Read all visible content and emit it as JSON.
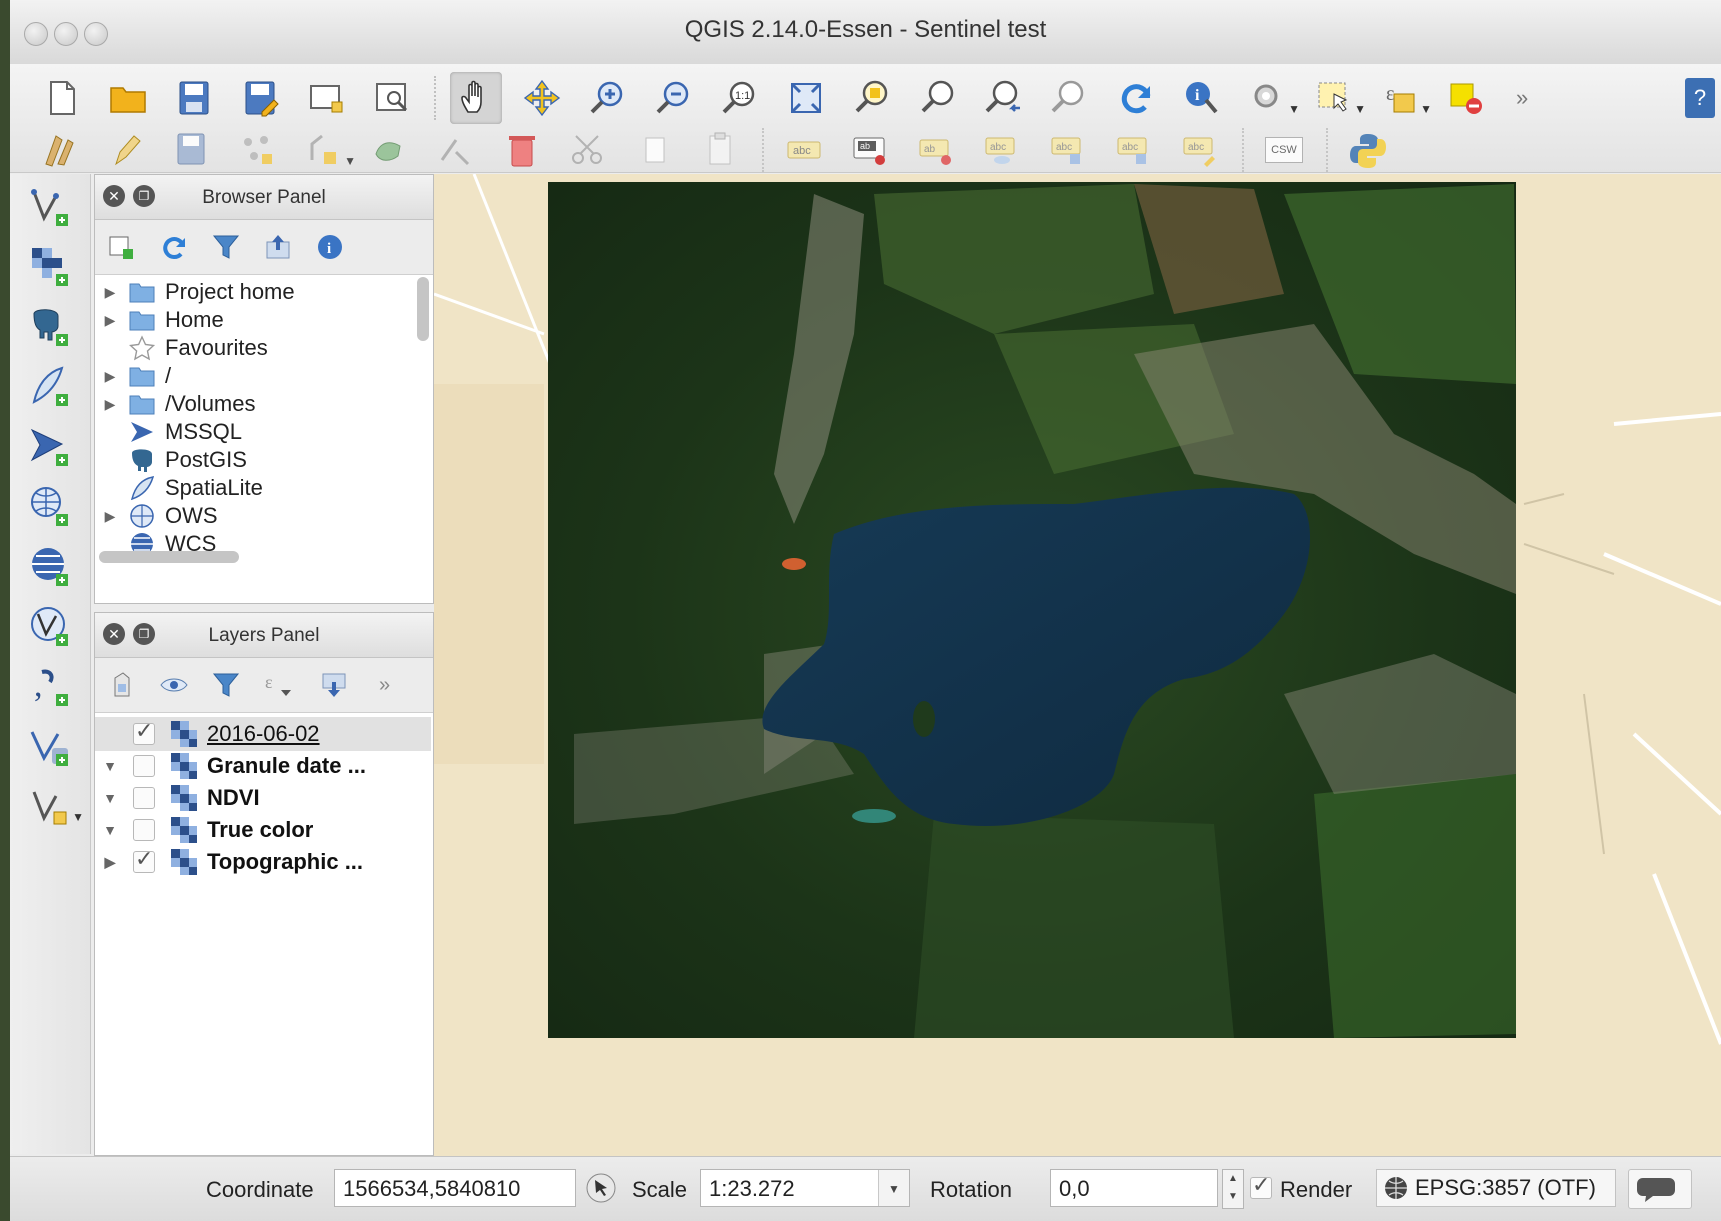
{
  "window": {
    "title": "QGIS 2.14.0-Essen - Sentinel test"
  },
  "toolbar_main": {
    "icons": [
      "new-project-icon",
      "open-project-icon",
      "save-project-icon",
      "save-as-icon",
      "new-print-composer-icon",
      "composer-manager-icon",
      "pan-icon",
      "pan-to-selection-icon",
      "zoom-in-icon",
      "zoom-out-icon",
      "zoom-native-icon",
      "zoom-full-icon",
      "zoom-to-selection-icon",
      "zoom-to-layer-icon",
      "zoom-last-icon",
      "zoom-next-icon",
      "refresh-icon",
      "identify-icon",
      "measure-icon",
      "select-icon",
      "expression-icon",
      "deselect-icon"
    ]
  },
  "toolbar_edit": {
    "csw_label": "CSW"
  },
  "browser_panel": {
    "title": "Browser Panel",
    "items": [
      {
        "label": "Project home",
        "icon": "folder-icon",
        "expandable": true
      },
      {
        "label": "Home",
        "icon": "folder-icon",
        "expandable": true
      },
      {
        "label": "Favourites",
        "icon": "star-icon",
        "expandable": false
      },
      {
        "label": "/",
        "icon": "folder-icon",
        "expandable": true
      },
      {
        "label": "/Volumes",
        "icon": "folder-icon",
        "expandable": true
      },
      {
        "label": "MSSQL",
        "icon": "mssql-icon",
        "expandable": false
      },
      {
        "label": "PostGIS",
        "icon": "postgis-icon",
        "expandable": false
      },
      {
        "label": "SpatiaLite",
        "icon": "spatialite-icon",
        "expandable": false
      },
      {
        "label": "OWS",
        "icon": "ows-icon",
        "expandable": true
      },
      {
        "label": "WCS",
        "icon": "wcs-icon",
        "expandable": false
      }
    ]
  },
  "layers_panel": {
    "title": "Layers Panel",
    "layers": [
      {
        "label": "2016-06-02",
        "checked": true,
        "selected": true,
        "expandable": false
      },
      {
        "label": "Granule date ...",
        "checked": false,
        "selected": false,
        "expandable": true
      },
      {
        "label": "NDVI",
        "checked": false,
        "selected": false,
        "expandable": true
      },
      {
        "label": "True color",
        "checked": false,
        "selected": false,
        "expandable": true
      },
      {
        "label": "Topographic ...",
        "checked": true,
        "selected": false,
        "expandable": true
      }
    ]
  },
  "status_bar": {
    "coordinate_label": "Coordinate",
    "coordinate_value": "1566534,5840810",
    "scale_label": "Scale",
    "scale_value": "1:23.272",
    "rotation_label": "Rotation",
    "rotation_value": "0,0",
    "render_label": "Render",
    "render_checked": true,
    "crs_label": "EPSG:3857 (OTF)"
  },
  "colors": {
    "lake": "#13324a",
    "forest": "#1f3a1c",
    "basemap": "#f0e4c6"
  }
}
